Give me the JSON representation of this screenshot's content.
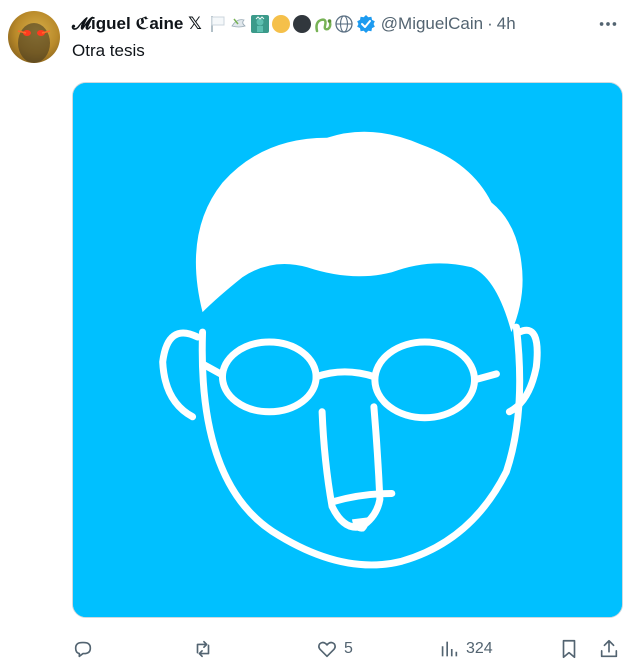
{
  "tweet": {
    "author_name": "𝓜iguel ℭaine 𝕏",
    "handle": "@MiguelCain",
    "separator": "·",
    "time": "4h",
    "text": "Otra tesis",
    "verified": true,
    "emojis": [
      "white-flag-icon",
      "dove-icon",
      "statue-of-liberty-icon",
      "yellow-circle-icon",
      "black-circle-icon",
      "snake-icon",
      "globe-icon"
    ],
    "media": {
      "background": "#00c0ff",
      "stroke": "#ffffff"
    }
  },
  "actions": {
    "reply_count": "",
    "retweet_count": "",
    "like_count": "5",
    "view_count": "324"
  },
  "colors": {
    "accent": "#1d9bf0",
    "muted": "#536471",
    "text": "#0f1419"
  }
}
